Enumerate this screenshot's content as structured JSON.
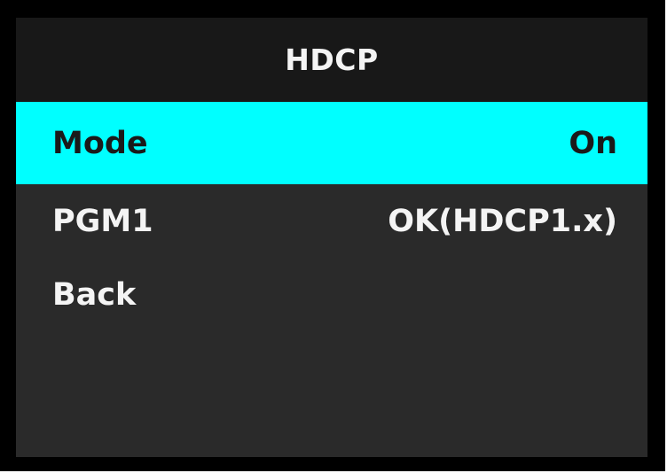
{
  "title": "HDCP",
  "colors": {
    "selected_background": "#00ffff",
    "screen_background": "#2a2a2a",
    "title_background": "#181818",
    "text": "#f4f4f4"
  },
  "menu": {
    "items": [
      {
        "label": "Mode",
        "value": "On",
        "selected": true
      },
      {
        "label": "PGM1",
        "value": "OK(HDCP1.x)",
        "selected": false
      },
      {
        "label": "Back",
        "value": "",
        "selected": false
      }
    ]
  }
}
